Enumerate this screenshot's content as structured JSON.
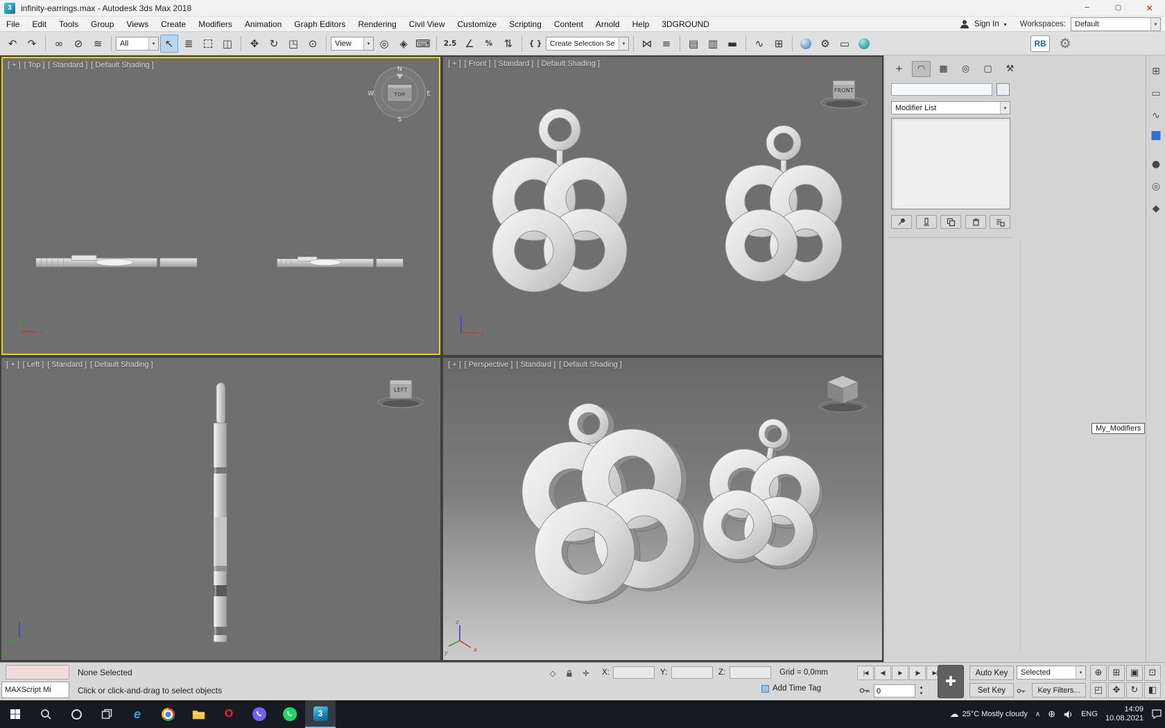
{
  "title_bar": {
    "app_title": "infinity-earrings.max - Autodesk 3ds Max 2018",
    "minimize_glyph": "─",
    "maximize_glyph": "▢",
    "close_glyph": "✕"
  },
  "menu_bar": {
    "items": [
      "File",
      "Edit",
      "Tools",
      "Group",
      "Views",
      "Create",
      "Modifiers",
      "Animation",
      "Graph Editors",
      "Rendering",
      "Civil View",
      "Customize",
      "Scripting",
      "Content",
      "Arnold",
      "Help",
      "3DGROUND"
    ],
    "sign_in_label": "Sign In",
    "workspaces_label": "Workspaces:",
    "workspace_selected": "Default"
  },
  "toolbar": {
    "selection_filter_value": "All",
    "coordinate_system_value": "View",
    "named_selection_value": "Create Selection Se",
    "snap_value": "2.5",
    "percent_glyph": "%",
    "rb_label": "RB"
  },
  "icons": {
    "undo": "↶",
    "redo": "↷",
    "select_and_link": "∞",
    "unlink_selection": "⊘",
    "bind_to_space_warp": "≋",
    "select_object": "↖",
    "select_by_name": "≣",
    "window_crossing": "◫",
    "select_and_move": "✥",
    "select_and_rotate": "↻",
    "select_and_scale": "◳",
    "select_and_place": "⊙",
    "use_pivot_center": "◎",
    "select_and_manipulate": "◈",
    "keyboard_override": "⌨",
    "angle_snap": "∠",
    "spinner_snap": "⇅",
    "named_sets": "{ }",
    "mirror": "⋈",
    "align": "≡",
    "scene_explorer": "▤",
    "layer_explorer": "▥",
    "ribbon": "▬",
    "curve_editor": "∿",
    "schematic_view": "⊞",
    "render_setup": "⚙",
    "rendered_frame": "▭",
    "gear": "⚙",
    "caret": "▾",
    "plus": "✚",
    "tab_create": "+",
    "tab_modify": "◠",
    "tab_hierarchy": "▦",
    "tab_motion": "◎",
    "tab_display": "▢",
    "tab_utilities": "⚒",
    "go_start": "|◀",
    "prev_frame": "◀|",
    "play": "▶",
    "next_frame": "|▶",
    "go_end": "▶|",
    "spin_up": "▴",
    "spin_down": "▾",
    "zoom": "⊕",
    "zoom_all": "⊞",
    "zoom_extents": "▣",
    "zoom_region": "⊡",
    "zoom_extents_all": "◰",
    "pan": "✥",
    "orbit": "↻",
    "maximize_viewport": "◧",
    "selection_region_status": "◇",
    "absolute_mode": "✛",
    "hidden_icons": "∧",
    "network": "⊕",
    "cloud": "☁",
    "strip_layout": "⊞",
    "strip_rect": "▭",
    "strip_spline": "∿",
    "strip_box": "■",
    "strip_sphere": "●",
    "strip_torus": "◎",
    "strip_teapot": "◆"
  },
  "viewports": {
    "top": {
      "segments": [
        "[ + ]",
        "[ Top ]",
        "[ Standard ]",
        "[ Default Shading ]"
      ],
      "compass": {
        "north": "N",
        "east": "E",
        "south": "S",
        "west": "W",
        "center_label": "TOP"
      }
    },
    "front": {
      "segments": [
        "[ + ]",
        "[ Front ]",
        "[ Standard ]",
        "[ Default Shading ]"
      ],
      "cube_label": "FRONT"
    },
    "left": {
      "segments": [
        "[ + ]",
        "[ Left ]",
        "[ Standard ]",
        "[ Default Shading ]"
      ],
      "cube_label": "LEFT"
    },
    "perspective": {
      "segments": [
        "[ + ]",
        "[ Perspective ]",
        "[ Standard ]",
        "[ Default Shading ]"
      ]
    },
    "axis": {
      "x": "x",
      "y": "y",
      "z": "z"
    }
  },
  "command_panel": {
    "modifier_list_label": "Modifier List",
    "my_modifiers_label": "My_Modifiers",
    "object_name_value": ""
  },
  "status_bar": {
    "maxscript_label": "MAXScript Mi",
    "selection_status": "None Selected",
    "prompt_line": "Click or click-and-drag to select objects",
    "x_label": "X:",
    "y_label": "Y:",
    "z_label": "Z:",
    "grid_label": "Grid = 0,0mm",
    "add_time_tag_label": "Add Time Tag",
    "auto_key_label": "Auto Key",
    "set_key_label": "Set Key",
    "key_mode_value": "Selected",
    "key_filters_label": "Key Filters...",
    "time_field_value": "0"
  },
  "taskbar": {
    "weather_text": "25°C Mostly cloudy",
    "language_label": "ENG",
    "clock_time": "14:09",
    "clock_date": "10.08.2021",
    "edge_letter": "e",
    "opera_letter": "O",
    "max_letter": "3"
  },
  "colors": {
    "active_viewport_border": "#edd500",
    "viewport_bg": "#6f6f6f",
    "taskbar_bg": "#171a21",
    "accent_blue": "#76b9ed"
  }
}
